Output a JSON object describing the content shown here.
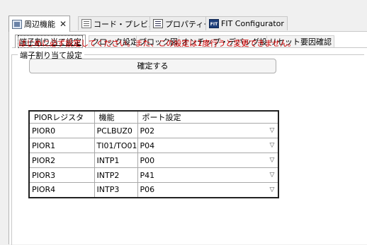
{
  "editor_tabs": [
    {
      "label": "周辺機能",
      "icon": "chip-icon",
      "active": true,
      "closable": true
    },
    {
      "label": "コード・プレビュー",
      "icon": "code-preview-icon",
      "active": false
    },
    {
      "label": "プロパティー",
      "icon": "properties-icon",
      "active": false
    },
    {
      "label": "FIT Configurator",
      "icon": "fit-icon",
      "active": false
    }
  ],
  "sub_tabs": [
    {
      "label": "端子割り当て設定",
      "active": true
    },
    {
      "label": "クロック設定"
    },
    {
      "label": "ブロック図"
    },
    {
      "label": "オンチップ・デバッグ設定"
    },
    {
      "label": "リセット要因確認"
    }
  ],
  "group": {
    "title": "端子割り当て設定",
    "notice": "はじめに必ず設定してください。また、この設定は1度行うと変更できません。",
    "notice_color": "#d40000",
    "confirm_label": "確定する"
  },
  "table": {
    "headers": [
      "PIORレジスタ",
      "機能",
      "ポート設定"
    ],
    "rows": [
      {
        "reg": "PIOR0",
        "func": "PCLBUZ0",
        "port": "P02"
      },
      {
        "reg": "PIOR1",
        "func": "TI01/TO01",
        "port": "P04"
      },
      {
        "reg": "PIOR2",
        "func": "INTP1",
        "port": "P00"
      },
      {
        "reg": "PIOR3",
        "func": "INTP2",
        "port": "P41"
      },
      {
        "reg": "PIOR4",
        "func": "INTP3",
        "port": "P06"
      }
    ]
  }
}
